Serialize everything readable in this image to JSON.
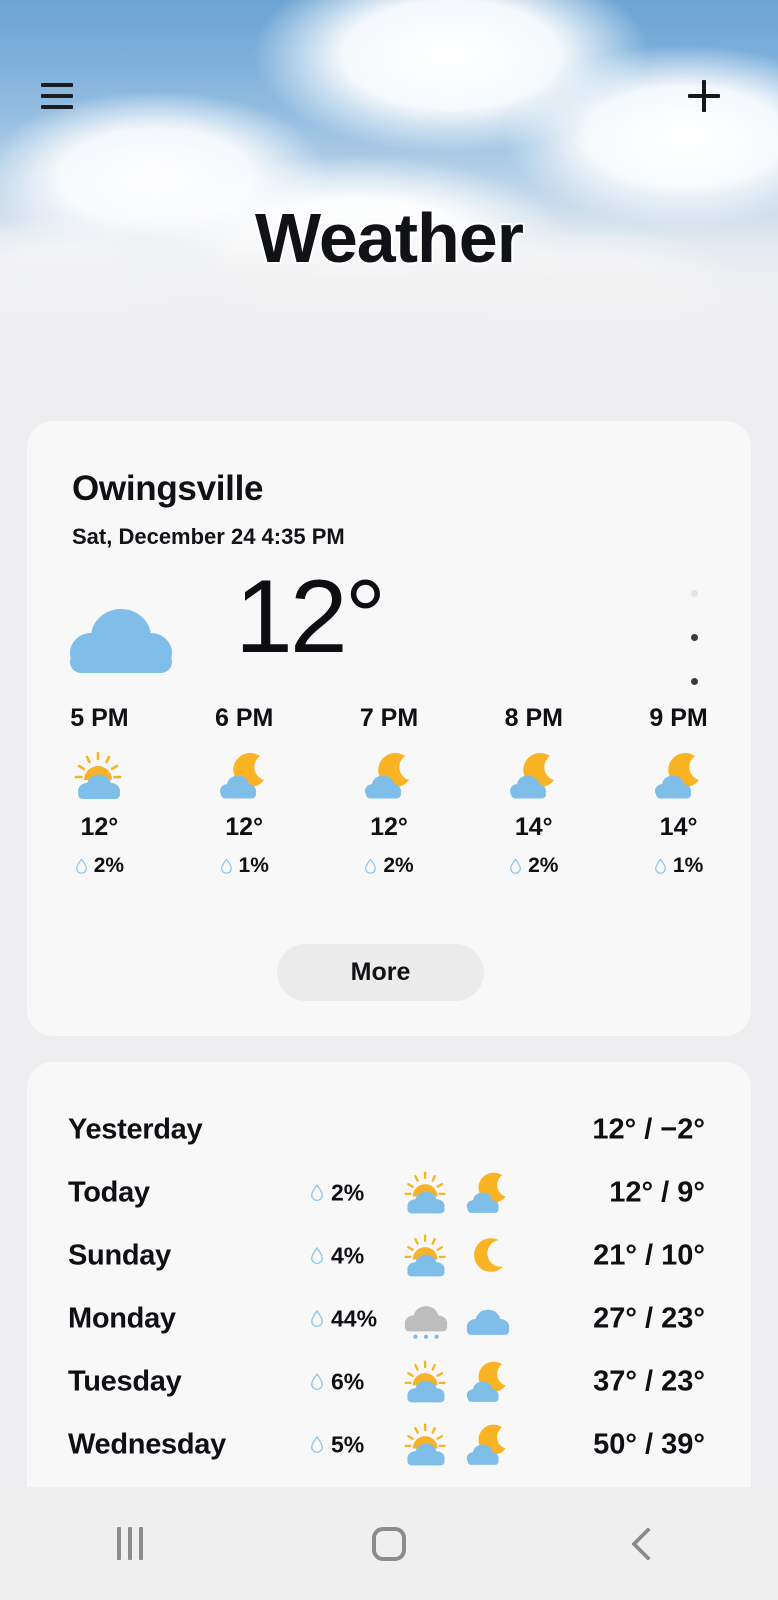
{
  "header": {
    "title": "Weather",
    "menu_icon": "hamburger-menu-icon",
    "add_icon": "plus-icon"
  },
  "current": {
    "city": "Owingsville",
    "datetime": "Sat, December 24 4:35 PM",
    "temperature": "12°",
    "condition_icon": "cloudy-icon",
    "overflow_icon": "kebab-menu-icon",
    "more_label": "More",
    "hourly": [
      {
        "time": "5 PM",
        "icon": "sun-behind-cloud-icon",
        "temp": "12°",
        "pop": "2%"
      },
      {
        "time": "6 PM",
        "icon": "moon-behind-cloud-icon",
        "temp": "12°",
        "pop": "1%"
      },
      {
        "time": "7 PM",
        "icon": "moon-behind-cloud-icon",
        "temp": "12°",
        "pop": "2%"
      },
      {
        "time": "8 PM",
        "icon": "moon-behind-cloud-icon",
        "temp": "14°",
        "pop": "2%"
      },
      {
        "time": "9 PM",
        "icon": "moon-behind-cloud-icon",
        "temp": "14°",
        "pop": "1%"
      }
    ]
  },
  "daily": [
    {
      "day": "Yesterday",
      "pop": "",
      "day_icon": "",
      "night_icon": "",
      "temps": "12° / −2°"
    },
    {
      "day": "Today",
      "pop": "2%",
      "day_icon": "sun-behind-cloud-icon",
      "night_icon": "moon-behind-cloud-icon",
      "temps": "12° / 9°"
    },
    {
      "day": "Sunday",
      "pop": "4%",
      "day_icon": "sun-behind-cloud-icon",
      "night_icon": "crescent-moon-icon",
      "temps": "21° / 10°"
    },
    {
      "day": "Monday",
      "pop": "44%",
      "day_icon": "snow-cloud-icon",
      "night_icon": "cloudy-icon",
      "temps": "27° / 23°"
    },
    {
      "day": "Tuesday",
      "pop": "6%",
      "day_icon": "sun-behind-cloud-icon",
      "night_icon": "moon-behind-cloud-icon",
      "temps": "37° / 23°"
    },
    {
      "day": "Wednesday",
      "pop": "5%",
      "day_icon": "sun-behind-cloud-icon",
      "night_icon": "moon-behind-cloud-icon",
      "temps": "50° / 39°"
    }
  ],
  "navbar": {
    "recents_icon": "recents-icon",
    "home_icon": "home-icon",
    "back_icon": "back-icon"
  },
  "colors": {
    "cloud_blue": "#7FBEE8",
    "sun_yellow": "#F8B22A",
    "moon_yellow": "#F9B323",
    "snow_cloud_gray": "#BDBDBD",
    "drop_blue": "#8FC6E8",
    "card_bg": "#F8F8F8",
    "page_bg": "#EEEEF0",
    "text": "#0F1013"
  }
}
